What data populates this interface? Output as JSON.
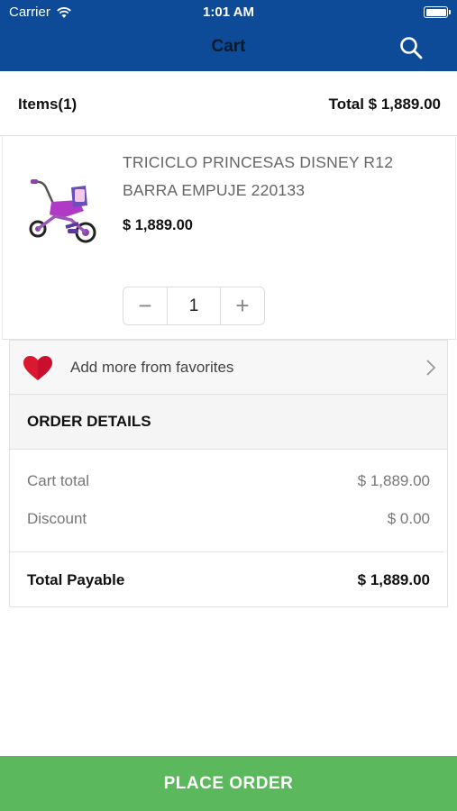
{
  "status_bar": {
    "carrier": "Carrier",
    "time": "1:01 AM"
  },
  "nav": {
    "title": "Cart",
    "search_icon": "search-icon"
  },
  "summary": {
    "items_label": "Items(1)",
    "total_label": "Total  $ 1,889.00"
  },
  "product": {
    "name": "TRICICLO PRINCESAS DISNEY R12 BARRA EMPUJE 220133",
    "price": "$ 1,889.00",
    "quantity": "1",
    "minus": "−",
    "plus": "+"
  },
  "favorites": {
    "label": "Add more from favorites"
  },
  "order_details": {
    "title": "ORDER DETAILS",
    "cart_total_label": "Cart total",
    "cart_total_value": "$ 1,889.00",
    "discount_label": "Discount",
    "discount_value": "$ 0.00",
    "payable_label": "Total Payable",
    "payable_value": "$ 1,889.00"
  },
  "actions": {
    "place_order": "PLACE ORDER"
  },
  "colors": {
    "brand": "#0d4a97",
    "action": "#5cb85c",
    "heart": "#c8102e"
  }
}
